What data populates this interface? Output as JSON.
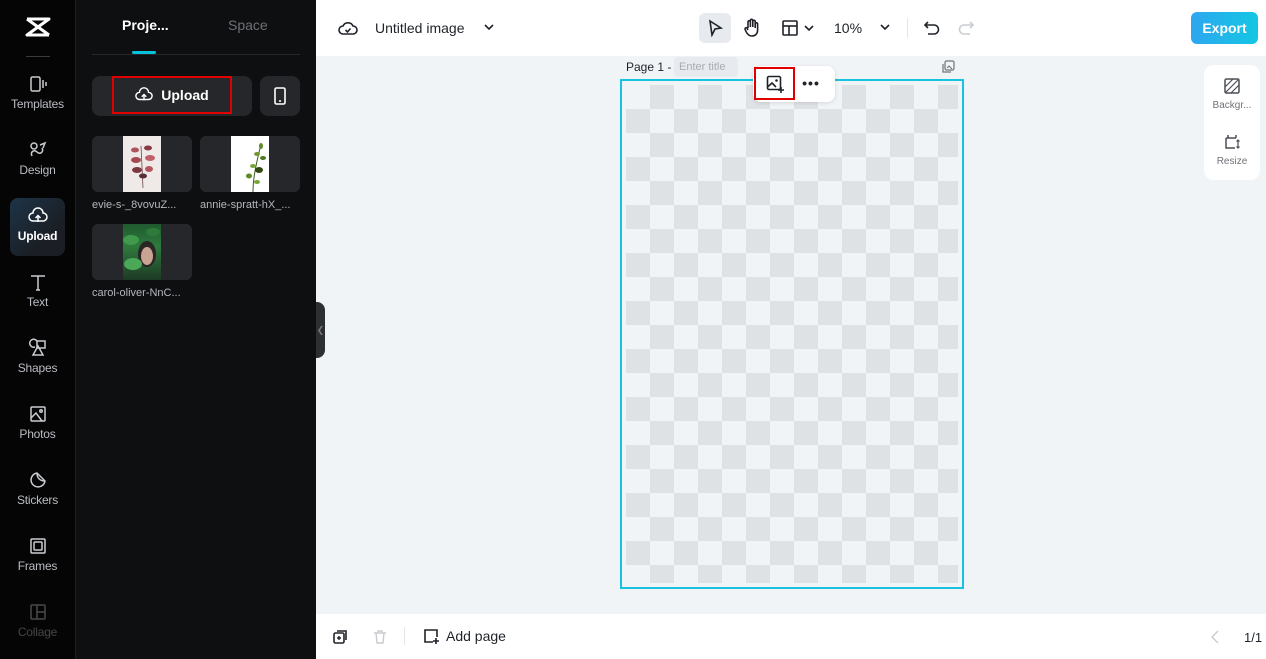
{
  "app": {
    "logo": "capcut-logo-icon"
  },
  "rail": {
    "items": [
      {
        "id": "templates",
        "label": "Templates",
        "icon": "templates-icon"
      },
      {
        "id": "design",
        "label": "Design",
        "icon": "design-icon"
      },
      {
        "id": "upload",
        "label": "Upload",
        "icon": "cloud-upload-icon",
        "active": true
      },
      {
        "id": "text",
        "label": "Text",
        "icon": "text-icon"
      },
      {
        "id": "shapes",
        "label": "Shapes",
        "icon": "shapes-icon"
      },
      {
        "id": "photos",
        "label": "Photos",
        "icon": "photo-icon"
      },
      {
        "id": "stickers",
        "label": "Stickers",
        "icon": "sticker-icon"
      },
      {
        "id": "frames",
        "label": "Frames",
        "icon": "frame-icon"
      },
      {
        "id": "collage",
        "label": "Collage",
        "icon": "collage-icon"
      }
    ]
  },
  "panel": {
    "tabs": [
      {
        "label": "Proje...",
        "active": true
      },
      {
        "label": "Space",
        "active": false
      }
    ],
    "upload_label": "Upload",
    "assets": [
      {
        "name": "evie-s-_8vovuZ..."
      },
      {
        "name": "annie-spratt-hX_..."
      },
      {
        "name": "carol-oliver-NnC..."
      }
    ]
  },
  "topbar": {
    "title": "Untitled image",
    "zoom": "10%",
    "export_label": "Export"
  },
  "canvas": {
    "page_label": "Page 1 -",
    "title_placeholder": "Enter title",
    "accent": "#19c3e0"
  },
  "right_tools": {
    "background_label": "Backgr...",
    "resize_label": "Resize"
  },
  "bottombar": {
    "add_page_label": "Add page",
    "page_count": "1/1"
  },
  "colors": {
    "highlight": "#e00000",
    "accent": "#00c1d9"
  }
}
